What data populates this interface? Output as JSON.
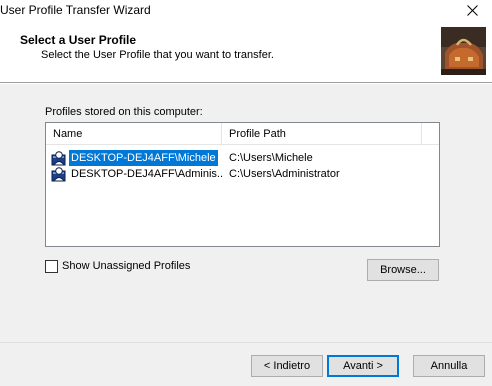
{
  "window": {
    "title": "User Profile Transfer Wizard"
  },
  "header": {
    "title": "Select a User Profile",
    "subtitle": "Select the User Profile that you want to transfer."
  },
  "profiles": {
    "label": "Profiles stored on this computer:",
    "columns": [
      "Name",
      "Profile Path"
    ],
    "rows": [
      {
        "name": "DESKTOP-DEJ4AFF\\Michele",
        "path": "C:\\Users\\Michele",
        "selected": true
      },
      {
        "name": "DESKTOP-DEJ4AFF\\Adminis...",
        "path": "C:\\Users\\Administrator",
        "selected": false
      }
    ]
  },
  "show_unassigned": {
    "label": "Show Unassigned Profiles",
    "checked": false
  },
  "buttons": {
    "browse": "Browse...",
    "back": "< Indietro",
    "next": "Avanti >",
    "cancel": "Annulla"
  },
  "colors": {
    "selection": "#0078d7",
    "body_bg": "#f0f0f0"
  },
  "icons": {
    "close": "close-icon",
    "wizard": "suitcase-icon",
    "user_profile": "user-profile-icon"
  }
}
